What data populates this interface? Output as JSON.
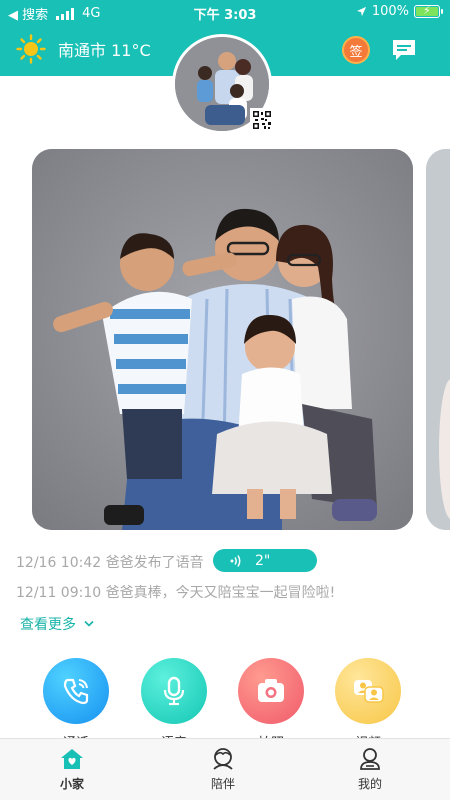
{
  "status_bar": {
    "back_label": "◀ 搜索",
    "network": "4G",
    "time": "下午 3:03",
    "battery": "100%"
  },
  "header": {
    "weather_icon": "sun-icon",
    "city_temp": "南通市 11°C",
    "sign_label": "签",
    "message_icon": "message-icon"
  },
  "feed": {
    "items": [
      {
        "time": "12/16 10:42",
        "text": "爸爸发布了语音"
      },
      {
        "time": "12/11 09:10",
        "text": "爸爸真棒，今天又陪宝宝一起冒险啦!"
      }
    ],
    "voice_duration": "2\"",
    "more_label": "查看更多"
  },
  "actions": [
    {
      "icon": "phone-icon",
      "label": "通话"
    },
    {
      "icon": "microphone-icon",
      "label": "语音"
    },
    {
      "icon": "camera-icon",
      "label": "拍照"
    },
    {
      "icon": "video-chat-icon",
      "label": "视频"
    }
  ],
  "tabs": [
    {
      "icon": "home-icon",
      "label": "小家",
      "active": true
    },
    {
      "icon": "companion-icon",
      "label": "陪伴",
      "active": false
    },
    {
      "icon": "profile-icon",
      "label": "我的",
      "active": false
    }
  ],
  "colors": {
    "brand": "#19c0b5",
    "feed_text": "#a8a8a8",
    "link": "#19b3aa"
  }
}
